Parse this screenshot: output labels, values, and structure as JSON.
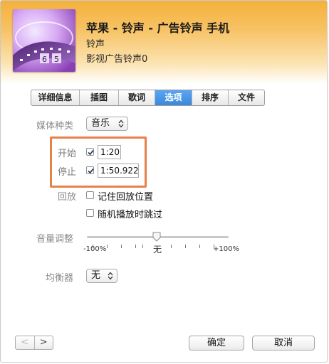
{
  "header": {
    "title": "苹果 - 铃声 - 广告铃声 手机",
    "artist": "铃声",
    "album": "影视广告铃声0"
  },
  "tabs": [
    {
      "label": "详细信息",
      "active": false
    },
    {
      "label": "插图",
      "active": false
    },
    {
      "label": "歌词",
      "active": false
    },
    {
      "label": "选项",
      "active": true
    },
    {
      "label": "排序",
      "active": false
    },
    {
      "label": "文件",
      "active": false
    }
  ],
  "options": {
    "media_kind_label": "媒体种类",
    "media_kind_value": "音乐",
    "start_label": "开始",
    "start_checked": true,
    "start_value": "1:20",
    "stop_label": "停止",
    "stop_checked": true,
    "stop_value": "1:50.922",
    "playback_label": "回放",
    "remember_position_label": "记住回放位置",
    "remember_position_checked": false,
    "skip_shuffle_label": "随机播放时跳过",
    "skip_shuffle_checked": false,
    "volume_label": "音量调整",
    "volume_min_label": "-100%",
    "volume_mid_label": "无",
    "volume_max_label": "+100%",
    "volume_adjust_percent": 0,
    "eq_label": "均衡器",
    "eq_value": "无"
  },
  "footer": {
    "prev_symbol": "<",
    "next_symbol": ">",
    "ok_label": "确定",
    "cancel_label": "取消"
  },
  "colors": {
    "header_orange": "#f4b13a",
    "tab_active_blue": "#3b87dc",
    "highlight_border": "#e8804a",
    "checkbox_check": "#2a3f63"
  }
}
